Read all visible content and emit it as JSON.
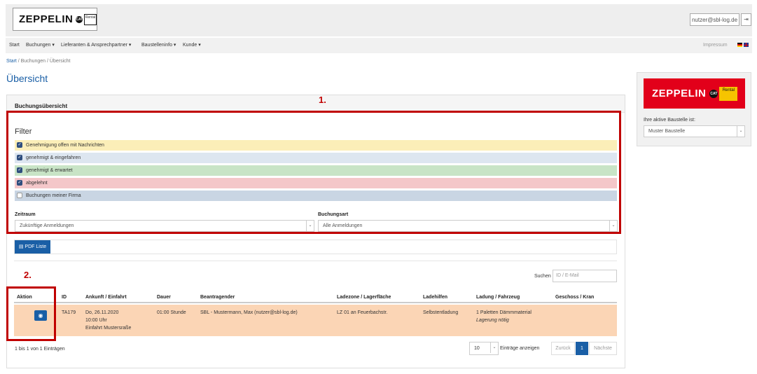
{
  "header": {
    "logo_text": "ZEPPELIN",
    "logo_badge": "CAT",
    "rental_badge": "Rental",
    "user_email": "nutzer@sbl-log.de",
    "logout_icon": "logout-icon"
  },
  "nav": {
    "items": [
      "Start",
      "Buchungen",
      "Lieferanten & Ansprechpartner",
      "Baustelleninfo",
      "Kunde"
    ],
    "impressum": "Impressum"
  },
  "breadcrumb": [
    "Start",
    "Buchungen",
    "Übersicht"
  ],
  "page_title": "Übersicht",
  "panel_title": "Buchungsübersicht",
  "callouts": [
    "1.",
    "2."
  ],
  "filter": {
    "title": "Filter",
    "options": [
      {
        "label": "Genehmigung offen mit Nachrichten",
        "checked": true,
        "color": "#fbeeb8"
      },
      {
        "label": "genehmigt & eingefahren",
        "checked": true,
        "color": "#dde6f0"
      },
      {
        "label": "genehmigt & erwartet",
        "checked": true,
        "color": "#c8e4c6"
      },
      {
        "label": "abgelehnt",
        "checked": true,
        "color": "#f4c7c9"
      },
      {
        "label": "Buchungen meiner Firma",
        "checked": false,
        "color": "#c9d5e3"
      }
    ],
    "zeitraum_label": "Zeitraum",
    "zeitraum_value": "Zukünftige Anmeldungen",
    "buchungsart_label": "Buchungsart",
    "buchungsart_value": "Alle Anmeldungen"
  },
  "pdf_button": "PDF Liste",
  "search": {
    "label": "Suchen",
    "placeholder": "ID / E-Mail"
  },
  "table": {
    "headers": [
      "Aktion",
      "ID",
      "Ankunft / Einfahrt",
      "Dauer",
      "Beantragender",
      "Ladezone / Lagerfläche",
      "Ladehilfen",
      "Ladung / Fahrzeug",
      "Geschoss / Kran"
    ],
    "rows": [
      {
        "id": "TA179",
        "arrival_date": "Do, 26.11.2020",
        "arrival_time": "10:00 Uhr",
        "arrival_gate": "Einfahrt Mustersraße",
        "duration": "01:00 Stunde",
        "requester": "SBL - Mustermann, Max (nutzer@sbl-log.de)",
        "zone": "LZ 01 an Feuerbachstr.",
        "aids": "Selbstentladung",
        "load": "1 Paletten Dämmmaterial",
        "load_note": "Lagerung nötig",
        "floor": "",
        "row_color": "#fbd5b5"
      }
    ]
  },
  "footer": {
    "info": "1 bis 1 von 1 Einträgen",
    "page_length": "10",
    "page_length_label": "Einträge anzeigen",
    "prev": "Zurück",
    "current_page": "1",
    "next": "Nächste"
  },
  "sidebar": {
    "logo_text": "ZEPPELIN",
    "logo_badge": "CAT",
    "rental_badge": "Rental",
    "site_label": "Ihre aktive Baustelle ist:",
    "site_value": "Muster Baustelle"
  },
  "colors": {
    "accent": "#1a5fa6",
    "highlight": "#c00000",
    "brand_red": "#e2001a"
  }
}
